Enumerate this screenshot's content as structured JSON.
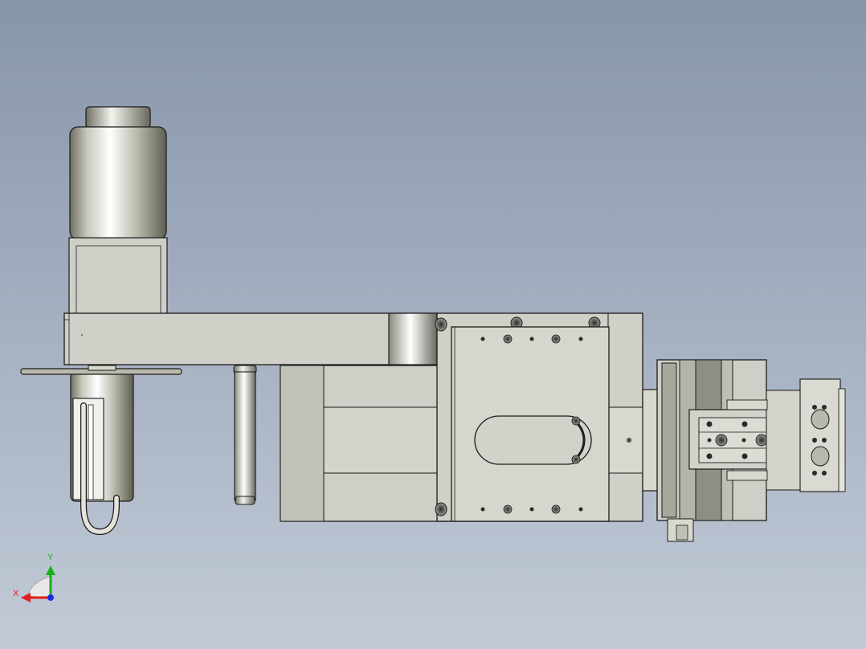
{
  "viewport": {
    "background_top": "#8795ab",
    "background_bottom": "#c2cad6"
  },
  "model": {
    "edge_color": "#1a1a1a",
    "face_color": "#cfcfc8",
    "metal_color": "#c9c9c0"
  },
  "triad": {
    "x_label": "X",
    "y_label": "Y",
    "x_color": "#e0201c",
    "y_color": "#18b018",
    "z_color": "#1c2ee0"
  }
}
